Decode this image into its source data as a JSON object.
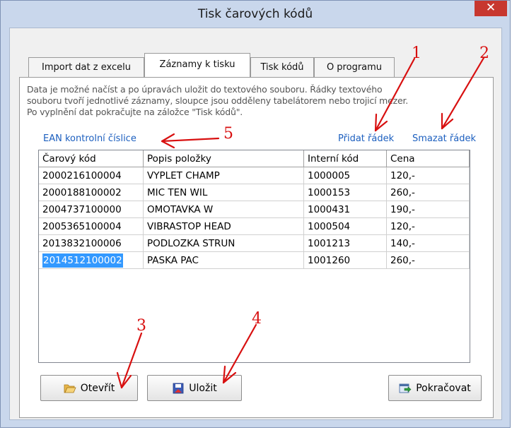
{
  "window": {
    "title": "Tisk čarových kódů",
    "close_glyph": "✕"
  },
  "tabs": [
    {
      "label": "Import dat z excelu",
      "active": false
    },
    {
      "label": "Záznamy k tisku",
      "active": true
    },
    {
      "label": "Tisk kódů",
      "active": false
    },
    {
      "label": "O programu",
      "active": false
    }
  ],
  "description": "Data je možné  načíst a po úpravách  uložit do  textového souboru.  Řádky  textového\nsouboru tvoří jednotlivé záznamy, sloupce jsou odděleny tabelátorem nebo trojicí mezer.\nPo vyplnění dat pokračujte na záložce \"Tisk kódů\".",
  "links": {
    "ean": "EAN kontrolní číslice",
    "add_row": "Přidat řádek",
    "delete_row": "Smazat řádek"
  },
  "table": {
    "columns": [
      "Čarový kód",
      "Popis položky",
      "Interní kód",
      "Cena"
    ],
    "rows": [
      [
        "2000216100004",
        "VYPLET CHAMP",
        "1000005",
        "120,-"
      ],
      [
        "2000188100002",
        "MIC TEN WIL",
        "1000153",
        "260,-"
      ],
      [
        "2004737100000",
        "OMOTAVKA W",
        "1000431",
        "190,-"
      ],
      [
        "2005365100004",
        "VIBRASTOP HEAD",
        "1000504",
        "120,-"
      ],
      [
        "2013832100006",
        "PODLOZKA STRUN",
        "1001213",
        "140,-"
      ],
      [
        "2014512100002",
        "PASKA PAC",
        "1001260",
        "260,-"
      ]
    ],
    "selected_row": 5
  },
  "buttons": {
    "open": "Otevřít",
    "save": "Uložit",
    "continue": "Pokračovat"
  },
  "icons": {
    "open": "folder-open-icon",
    "save": "save-icon",
    "continue": "continue-icon"
  },
  "annotations": [
    "1",
    "2",
    "3",
    "4",
    "5"
  ],
  "colors": {
    "annotation": "#d81010",
    "link": "#1c5fbf",
    "selection": "#3399ff",
    "close_button": "#c7372f",
    "window_frame": "#c9d7ec"
  }
}
